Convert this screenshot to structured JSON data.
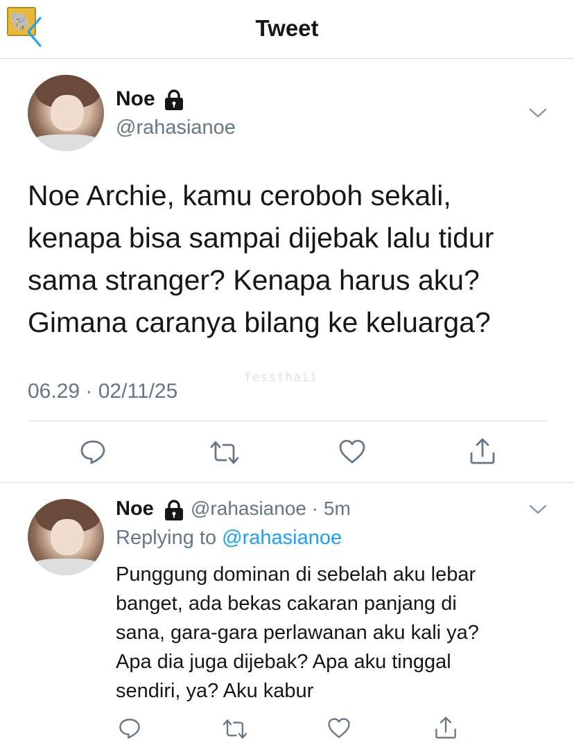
{
  "header": {
    "title": "Tweet",
    "back_emoji": "🐘"
  },
  "tweet": {
    "author_name": "Noe",
    "author_handle": "@rahasianoe",
    "text": "Noe Archie, kamu ceroboh sekali,\nkenapa bisa sampai dijebak lalu tidur\nsama stranger? Kenapa harus aku?\nGimana caranya bilang ke keluarga?",
    "watermark": "fessthaii",
    "timestamp": "06.29 · 02/11/25"
  },
  "reply": {
    "author_name": "Noe",
    "author_handle": "@rahasianoe",
    "separator": "·",
    "time": "5m",
    "replying_prefix": "Replying to",
    "replying_mention": "@rahasianoe",
    "text": "Punggung dominan di sebelah aku lebar\nbanget, ada bekas cakaran panjang di\nsana, gara-gara perlawanan aku kali ya?\nApa dia juga dijebak? Apa aku tinggal\nsendiri, ya? Aku kabur"
  },
  "icons": {
    "back": "back-arrow-icon",
    "lock": "lock-icon",
    "more": "chevron-down-icon",
    "reply": "reply-icon",
    "retweet": "retweet-icon",
    "like": "heart-icon",
    "share": "share-icon"
  },
  "colors": {
    "text": "#14171a",
    "secondary": "#657786",
    "accent": "#1da1f2",
    "divider": "#d9dde1"
  }
}
